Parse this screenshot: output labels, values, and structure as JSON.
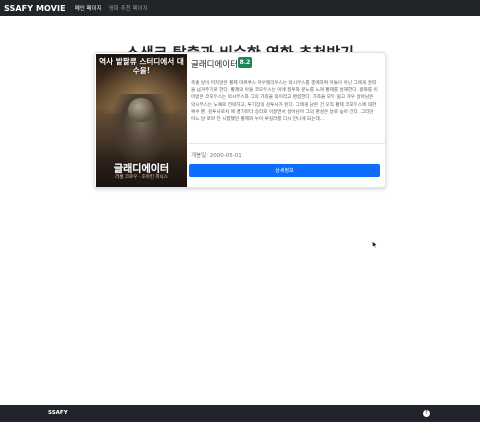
{
  "navbar": {
    "brand": "SSAFY MOVIE",
    "links": [
      {
        "label": "메인 페이지",
        "active": true
      },
      {
        "label": "영화 추천 페이지",
        "active": false
      }
    ]
  },
  "page": {
    "title": "쇼생크 탈출과 비슷한 영화 추천받기"
  },
  "movie": {
    "title": "글래디에이터",
    "rating": "8.2",
    "overview": "축출 날이 머지않은 황제 마르쿠스 아우렐리우스는 막시무스를 총애하여 아들이 아닌 그에게 권력을 넘겨주기로 한다. 황제의 아들 코모두스는 이에 질투와 분노를 느껴 황제를 살해한다. 왕좌를 이어받은 코모두스는 막시무스와 그의 가족을 죽이라고 명령한다. 가족을 모두 잃고 겨우 살아남은 막시무스는 노예로 전락하고, 투기장의 검투사가 된다. 그에게 남은 건 오직 황제 코모두스에 대한 복수 뿐. 검투사로서 매 경기마다 승리로 이끌면서 살아남아 그의 명성은 날로 높아 간다. 그러던 어느 날 로마 전 시합했던 황제와 누이 루실라를 다시 만나게 되는데...",
    "release_label": "개봉일: 2000-05-01",
    "detail_button": "상세정보",
    "poster": {
      "tagline": "역사 밭팔류 스터디에서 대수을!",
      "title": "글래디에이터",
      "subtitle": "러셀 크로우 · 호아킨 피닉스"
    }
  },
  "footer": {
    "brand": "SSAFY",
    "top_icon": "arrow-up-icon"
  },
  "colors": {
    "navbar_bg": "#212529",
    "rating_badge": "#198754",
    "button_primary": "#0d6efd"
  }
}
